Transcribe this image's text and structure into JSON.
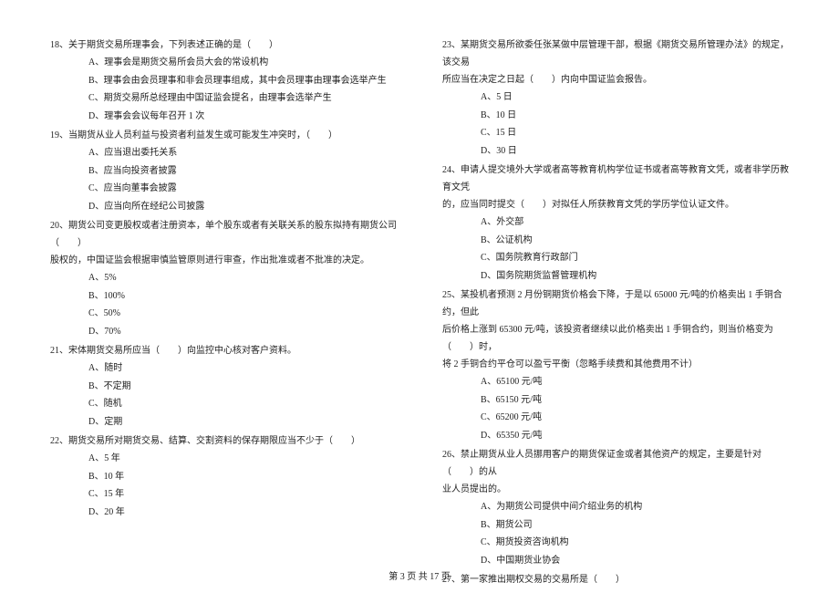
{
  "left": {
    "q18": {
      "stem": "18、关于期货交易所理事会，下列表述正确的是（　　）",
      "opts": [
        "A、理事会是期货交易所会员大会的常设机构",
        "B、理事会由会员理事和非会员理事组成，其中会员理事由理事会选举产生",
        "C、期货交易所总经理由中国证监会提名，由理事会选举产生",
        "D、理事会会议每年召开 1 次"
      ]
    },
    "q19": {
      "stem": "19、当期货从业人员利益与投资者利益发生或可能发生冲突时，（　　）",
      "opts": [
        "A、应当退出委托关系",
        "B、应当向投资者披露",
        "C、应当向董事会披露",
        "D、应当向所在经纪公司披露"
      ]
    },
    "q20": {
      "stem": "20、期货公司变更股权或者注册资本，单个股东或者有关联关系的股东拟持有期货公司（　　）",
      "cont": "股权的，中国证监会根据审慎监管原则进行审查，作出批准或者不批准的决定。",
      "opts": [
        "A、5%",
        "B、100%",
        "C、50%",
        "D、70%"
      ]
    },
    "q21": {
      "stem": "21、宋体期货交易所应当（　　）向监控中心核对客户资料。",
      "opts": [
        "A、随时",
        "B、不定期",
        "C、随机",
        "D、定期"
      ]
    },
    "q22": {
      "stem": "22、期货交易所对期货交易、结算、交割资料的保存期限应当不少于（　　）",
      "opts": [
        "A、5 年",
        "B、10 年",
        "C、15 年",
        "D、20 年"
      ]
    }
  },
  "right": {
    "q23": {
      "stem": "23、某期货交易所欲委任张某做中层管理干部，根据《期货交易所管理办法》的规定，该交易",
      "cont": "所应当在决定之日起（　　）内向中国证监会报告。",
      "opts": [
        "A、5 日",
        "B、10 日",
        "C、15 日",
        "D、30 日"
      ]
    },
    "q24": {
      "stem": "24、申请人提交境外大学或者高等教育机构学位证书或者高等教育文凭，或者非学历教育文凭",
      "cont": "的，应当同时提交（　　）对拟任人所获教育文凭的学历学位认证文件。",
      "opts": [
        "A、外交部",
        "B、公证机构",
        "C、国务院教育行政部门",
        "D、国务院期货监督管理机构"
      ]
    },
    "q25": {
      "stem": "25、某投机者预测 2 月份铜期货价格会下降，于是以 65000 元/吨的价格卖出 1 手铜合约，但此",
      "cont1": "后价格上涨到 65300 元/吨，该投资者继续以此价格卖出 1 手铜合约，则当价格变为（　　）时，",
      "cont2": "将 2 手铜合约平仓可以盈亏平衡（忽略手续费和其他费用不计）",
      "opts": [
        "A、65100 元/吨",
        "B、65150 元/吨",
        "C、65200 元/吨",
        "D、65350 元/吨"
      ]
    },
    "q26": {
      "stem": "26、禁止期货从业人员挪用客户的期货保证金或者其他资产的规定，主要是针对（　　）的从",
      "cont": "业人员提出的。",
      "opts": [
        "A、为期货公司提供中间介绍业务的机构",
        "B、期货公司",
        "C、期货投资咨询机构",
        "D、中国期货业协会"
      ]
    },
    "q27": {
      "stem": "27、第一家推出期权交易的交易所是（　　）"
    }
  },
  "footer": "第 3 页 共 17 页"
}
